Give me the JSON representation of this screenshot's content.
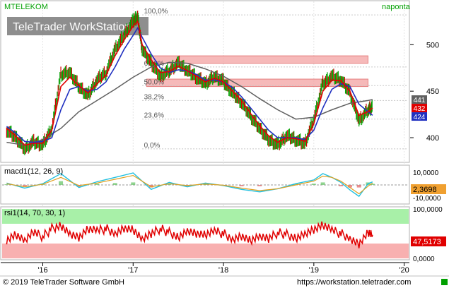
{
  "header": {
    "symbol": "MTELEKOM",
    "period": "naponta",
    "watermark": "TeleTrader WorkStation"
  },
  "footer": {
    "copyright": "© 2019 TeleTrader Software GmbH",
    "url": "https://workstation.teletrader.com"
  },
  "colors": {
    "price_up": "#00a000",
    "price_down": "#d00000",
    "ma_fast": "#e00000",
    "ma_mid": "#2030c0",
    "ma_slow": "#606060",
    "fib_zone": "#f4a8a8",
    "rsi_top": "#a8f0a8",
    "rsi_bottom": "#f8b0b0",
    "accent_green": "#00a000"
  },
  "chart_data": [
    {
      "type": "line",
      "name": "price",
      "x_ticks": [
        "'16",
        "'17",
        "'18",
        "'19",
        "'20"
      ],
      "x_tick_pos": [
        2016.0,
        2017.0,
        2018.0,
        2019.0,
        2020.0
      ],
      "xlim": [
        2015.55,
        2020.05
      ],
      "ylim": [
        375,
        545
      ],
      "y_ticks": [
        400,
        450,
        500
      ],
      "series_price": {
        "x": [
          2015.6,
          2015.7,
          2015.8,
          2015.9,
          2016.0,
          2016.1,
          2016.2,
          2016.3,
          2016.4,
          2016.5,
          2016.6,
          2016.7,
          2016.8,
          2016.9,
          2017.0,
          2017.05,
          2017.1,
          2017.2,
          2017.3,
          2017.4,
          2017.5,
          2017.6,
          2017.7,
          2017.8,
          2017.9,
          2018.0,
          2018.1,
          2018.2,
          2018.3,
          2018.4,
          2018.5,
          2018.6,
          2018.7,
          2018.8,
          2018.9,
          2019.0,
          2019.1,
          2019.2,
          2019.3,
          2019.4,
          2019.5,
          2019.6,
          2019.65
        ],
        "y": [
          408,
          400,
          388,
          395,
          392,
          410,
          468,
          470,
          455,
          445,
          462,
          470,
          495,
          510,
          525,
          530,
          495,
          480,
          466,
          472,
          480,
          472,
          465,
          458,
          466,
          460,
          448,
          438,
          423,
          410,
          398,
          392,
          402,
          398,
          393,
          420,
          458,
          466,
          462,
          448,
          418,
          430,
          433
        ]
      },
      "series_ma_fast": {
        "x": [
          2015.6,
          2015.7,
          2015.8,
          2015.9,
          2016.0,
          2016.1,
          2016.2,
          2016.3,
          2016.4,
          2016.5,
          2016.6,
          2016.7,
          2016.8,
          2016.9,
          2017.0,
          2017.05,
          2017.1,
          2017.2,
          2017.3,
          2017.4,
          2017.5,
          2017.6,
          2017.7,
          2017.8,
          2017.9,
          2018.0,
          2018.1,
          2018.2,
          2018.3,
          2018.4,
          2018.5,
          2018.6,
          2018.7,
          2018.8,
          2018.9,
          2019.0,
          2019.1,
          2019.2,
          2019.3,
          2019.4,
          2019.5,
          2019.6,
          2019.65
        ],
        "y": [
          410,
          402,
          392,
          394,
          394,
          408,
          455,
          465,
          456,
          448,
          458,
          467,
          488,
          505,
          520,
          525,
          500,
          484,
          470,
          471,
          477,
          472,
          466,
          460,
          464,
          460,
          450,
          440,
          426,
          413,
          402,
          395,
          400,
          399,
          396,
          415,
          450,
          462,
          461,
          450,
          424,
          428,
          432
        ]
      },
      "series_ma_mid": {
        "x": [
          2015.6,
          2015.7,
          2015.8,
          2015.9,
          2016.0,
          2016.1,
          2016.2,
          2016.3,
          2016.4,
          2016.5,
          2016.6,
          2016.7,
          2016.8,
          2016.9,
          2017.0,
          2017.05,
          2017.1,
          2017.2,
          2017.3,
          2017.4,
          2017.5,
          2017.6,
          2017.7,
          2017.8,
          2017.9,
          2018.0,
          2018.1,
          2018.2,
          2018.3,
          2018.4,
          2018.5,
          2018.6,
          2018.7,
          2018.8,
          2018.9,
          2019.0,
          2019.1,
          2019.2,
          2019.3,
          2019.4,
          2019.5,
          2019.6,
          2019.65
        ],
        "y": [
          412,
          405,
          396,
          395,
          396,
          400,
          430,
          452,
          455,
          450,
          452,
          460,
          476,
          495,
          510,
          518,
          508,
          490,
          475,
          470,
          473,
          472,
          468,
          462,
          462,
          460,
          454,
          444,
          432,
          420,
          408,
          400,
          400,
          400,
          398,
          408,
          432,
          452,
          458,
          455,
          436,
          428,
          424
        ]
      },
      "series_ma_slow": {
        "x": [
          2015.6,
          2015.8,
          2016.0,
          2016.2,
          2016.4,
          2016.6,
          2016.8,
          2017.0,
          2017.2,
          2017.4,
          2017.6,
          2017.8,
          2018.0,
          2018.2,
          2018.4,
          2018.6,
          2018.8,
          2019.0,
          2019.2,
          2019.4,
          2019.6,
          2019.65
        ],
        "y": [
          395,
          392,
          398,
          410,
          428,
          440,
          452,
          465,
          476,
          481,
          480,
          474,
          466,
          455,
          442,
          430,
          420,
          422,
          430,
          437,
          440,
          441
        ]
      },
      "fib_levels": [
        {
          "label": "100,0%",
          "y": 532
        },
        {
          "label": "61,8%",
          "y": 476
        },
        {
          "label": "50,0%",
          "y": 456
        },
        {
          "label": "38,2%",
          "y": 440
        },
        {
          "label": "23,6%",
          "y": 420
        },
        {
          "label": "0,0%",
          "y": 388
        }
      ],
      "fib_zones": [
        {
          "x0": 2017.15,
          "x1": 2019.6,
          "y0": 480,
          "y1": 488
        },
        {
          "x0": 2017.15,
          "x1": 2019.6,
          "y0": 455,
          "y1": 463
        }
      ],
      "last_values": [
        {
          "label": "441",
          "value": 441,
          "color": "#606060"
        },
        {
          "label": "432",
          "value": 432,
          "color": "#e00000"
        },
        {
          "label": "424",
          "value": 424,
          "color": "#2030c0"
        }
      ]
    },
    {
      "type": "line",
      "name": "macd",
      "title": "macd1(12, 26, 9)",
      "ylim": [
        -14000,
        14000
      ],
      "y_ticks": [
        "10,0000",
        "-10,0000"
      ],
      "y_tick_values": [
        10000,
        -10000
      ],
      "last_label": "2,3698",
      "x": [
        2015.6,
        2015.8,
        2016.0,
        2016.2,
        2016.4,
        2016.6,
        2016.8,
        2017.0,
        2017.2,
        2017.4,
        2017.6,
        2017.8,
        2018.0,
        2018.2,
        2018.4,
        2018.6,
        2018.8,
        2019.0,
        2019.1,
        2019.2,
        2019.3,
        2019.4,
        2019.5,
        2019.6,
        2019.65
      ],
      "macd": [
        1500,
        -2500,
        1000,
        9000,
        -2000,
        2500,
        6000,
        9500,
        -3500,
        2000,
        -1500,
        1500,
        -500,
        -3500,
        -5500,
        -3000,
        1000,
        4000,
        9000,
        6000,
        2000,
        -4000,
        -9000,
        1000,
        2400
      ],
      "signal": [
        1000,
        -1500,
        500,
        6000,
        -500,
        1500,
        4500,
        7500,
        -1500,
        1000,
        -500,
        800,
        -200,
        -2500,
        -4500,
        -3000,
        0,
        3000,
        7000,
        6000,
        3000,
        -2000,
        -7000,
        -1000,
        1500
      ]
    },
    {
      "type": "line",
      "name": "rsi",
      "title": "rsi1(14, 70, 30, 1)",
      "ylim": [
        0,
        100
      ],
      "y_ticks": [
        "100,0000",
        "0,0000"
      ],
      "y_tick_values": [
        100,
        0
      ],
      "overbought": 70,
      "oversold": 30,
      "last_label": "47,5173",
      "x": [
        2015.6,
        2015.7,
        2015.8,
        2015.9,
        2016.0,
        2016.1,
        2016.2,
        2016.3,
        2016.4,
        2016.5,
        2016.6,
        2016.7,
        2016.8,
        2016.9,
        2017.0,
        2017.1,
        2017.2,
        2017.3,
        2017.4,
        2017.5,
        2017.6,
        2017.7,
        2017.8,
        2017.9,
        2018.0,
        2018.1,
        2018.2,
        2018.3,
        2018.4,
        2018.5,
        2018.6,
        2018.7,
        2018.8,
        2018.9,
        2019.0,
        2019.1,
        2019.2,
        2019.3,
        2019.4,
        2019.5,
        2019.6,
        2019.65
      ],
      "y": [
        38,
        48,
        35,
        52,
        44,
        60,
        68,
        50,
        42,
        58,
        55,
        60,
        52,
        62,
        58,
        38,
        48,
        60,
        52,
        44,
        56,
        50,
        46,
        54,
        50,
        40,
        46,
        36,
        44,
        38,
        52,
        48,
        42,
        50,
        58,
        66,
        56,
        50,
        42,
        30,
        52,
        47.5
      ]
    }
  ]
}
